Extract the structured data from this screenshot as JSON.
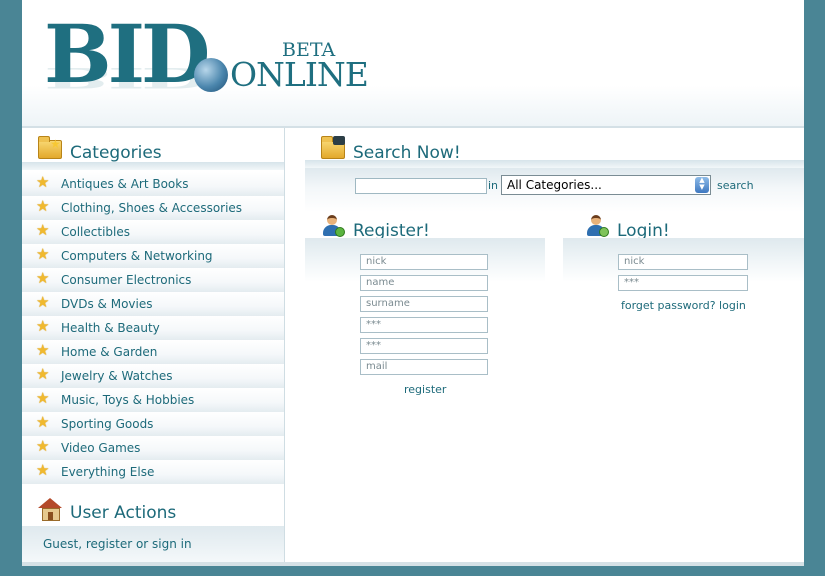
{
  "logo": {
    "bid": "BID",
    "online": "ONLINE",
    "beta": "BETA"
  },
  "sidebar": {
    "categories_title": "Categories",
    "categories": [
      "Antiques & Art Books",
      "Clothing, Shoes & Accessories",
      "Collectibles",
      "Computers & Networking",
      "Consumer Electronics",
      "DVDs & Movies",
      "Health & Beauty",
      "Home & Garden",
      "Jewelry & Watches",
      "Music, Toys & Hobbies",
      "Sporting Goods",
      "Video Games",
      "Everything Else"
    ],
    "user_actions_title": "User Actions",
    "user_actions_text": "Guest, register or sign in"
  },
  "search": {
    "title": "Search Now!",
    "query": "",
    "in_label": "in",
    "category_selected": "All Categories...",
    "button": "search"
  },
  "register": {
    "title": "Register!",
    "fields": [
      "nick",
      "name",
      "surname",
      "***",
      "***",
      "mail"
    ],
    "button": "register"
  },
  "login": {
    "title": "Login!",
    "fields": [
      "nick",
      "***"
    ],
    "forget_link": "forget password? login"
  },
  "colors": {
    "background": "#4a8595",
    "accent": "#1d6a7a"
  }
}
